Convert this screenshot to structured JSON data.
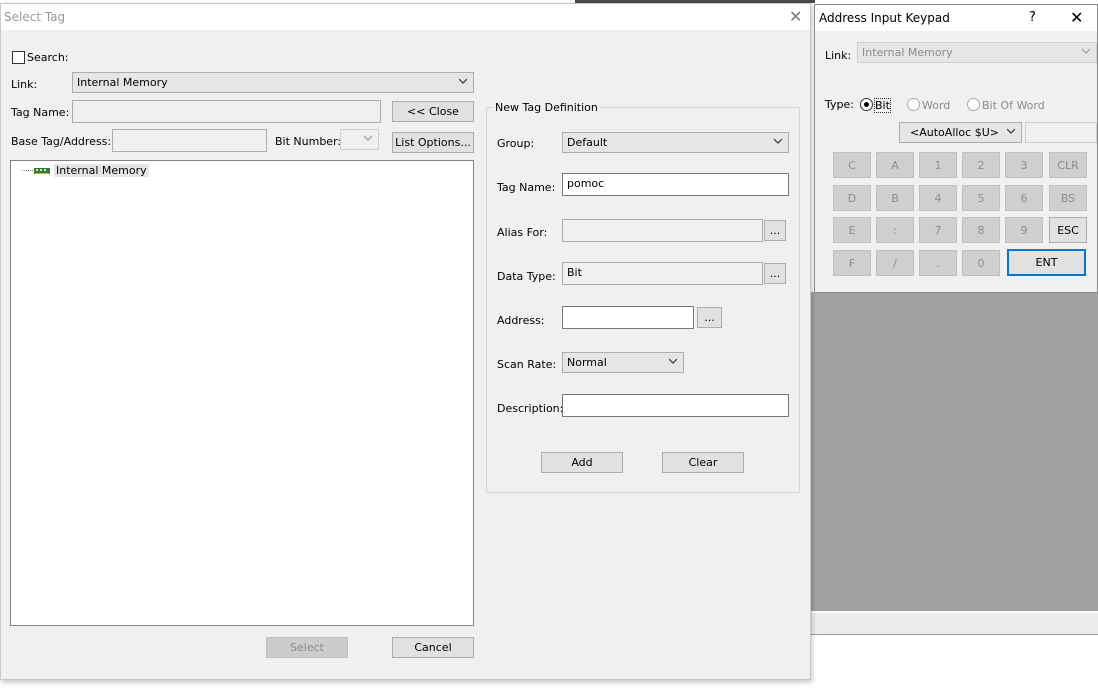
{
  "select_tag": {
    "title": "Select Tag",
    "search_label": "Search:",
    "link_label": "Link:",
    "link_value": "Internal Memory",
    "tag_name_label": "Tag Name:",
    "tag_name_value": "",
    "close_button": "<< Close",
    "base_tag_label": "Base Tag/Address:",
    "base_tag_value": "",
    "bit_number_label": "Bit Number:",
    "bit_number_value": "",
    "list_options_button": "List Options...",
    "tree": [
      {
        "label": "Internal Memory",
        "icon": "memory-chip-icon"
      }
    ],
    "new_tag": {
      "title": "New Tag Definition",
      "group_label": "Group:",
      "group_value": "Default",
      "tag_name_label": "Tag Name:",
      "tag_name_value": "pomoc",
      "alias_label": "Alias For:",
      "alias_value": "",
      "data_type_label": "Data Type:",
      "data_type_value": "Bit",
      "address_label": "Address:",
      "address_value": "",
      "scan_rate_label": "Scan Rate:",
      "scan_rate_value": "Normal",
      "description_label": "Description:",
      "description_value": "",
      "browse_label": "...",
      "add_button": "Add",
      "clear_button": "Clear"
    },
    "select_button": "Select",
    "cancel_button": "Cancel"
  },
  "keypad": {
    "title": "Address Input Keypad",
    "help": "?",
    "link_label": "Link:",
    "link_value": "Internal Memory",
    "type_label": "Type:",
    "types": [
      "Bit",
      "Word",
      "Bit Of Word"
    ],
    "selected_type": "Bit",
    "autoalloc_value": "<AutoAlloc $U>",
    "keys": [
      [
        "C",
        "A",
        "1",
        "2",
        "3",
        "CLR"
      ],
      [
        "D",
        "B",
        "4",
        "5",
        "6",
        "BS"
      ],
      [
        "E",
        ":",
        "7",
        "8",
        "9",
        "ESC"
      ],
      [
        "F",
        "/",
        ".",
        "0",
        "ENT"
      ]
    ]
  },
  "colors": {
    "accent": "#0078d7"
  }
}
